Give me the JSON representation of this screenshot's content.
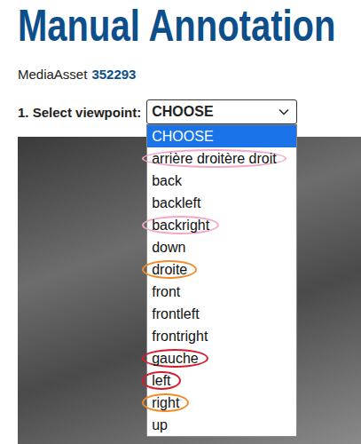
{
  "page": {
    "title": "Manual Annotation",
    "media_asset": {
      "label": "MediaAsset",
      "id": "352293"
    }
  },
  "viewpoint": {
    "label": "1. Select viewpoint:",
    "value": "CHOOSE",
    "open": true,
    "options": [
      {
        "label": "CHOOSE",
        "selected": true,
        "circled": false
      },
      {
        "label": "arrière droitère droit",
        "selected": false,
        "circled": true,
        "color": "#f2a7c9"
      },
      {
        "label": "back",
        "selected": false,
        "circled": false
      },
      {
        "label": "backleft",
        "selected": false,
        "circled": false
      },
      {
        "label": "backright",
        "selected": false,
        "circled": true,
        "color": "#f2a7c9"
      },
      {
        "label": "down",
        "selected": false,
        "circled": false
      },
      {
        "label": "droite",
        "selected": false,
        "circled": true,
        "color": "#f28c28"
      },
      {
        "label": "front",
        "selected": false,
        "circled": false
      },
      {
        "label": "frontleft",
        "selected": false,
        "circled": false
      },
      {
        "label": "frontright",
        "selected": false,
        "circled": false
      },
      {
        "label": "gauche",
        "selected": false,
        "circled": true,
        "color": "#d81b2c"
      },
      {
        "label": "left",
        "selected": false,
        "circled": true,
        "color": "#d81b2c"
      },
      {
        "label": "right",
        "selected": false,
        "circled": true,
        "color": "#f28c28"
      },
      {
        "label": "up",
        "selected": false,
        "circled": false
      }
    ]
  }
}
